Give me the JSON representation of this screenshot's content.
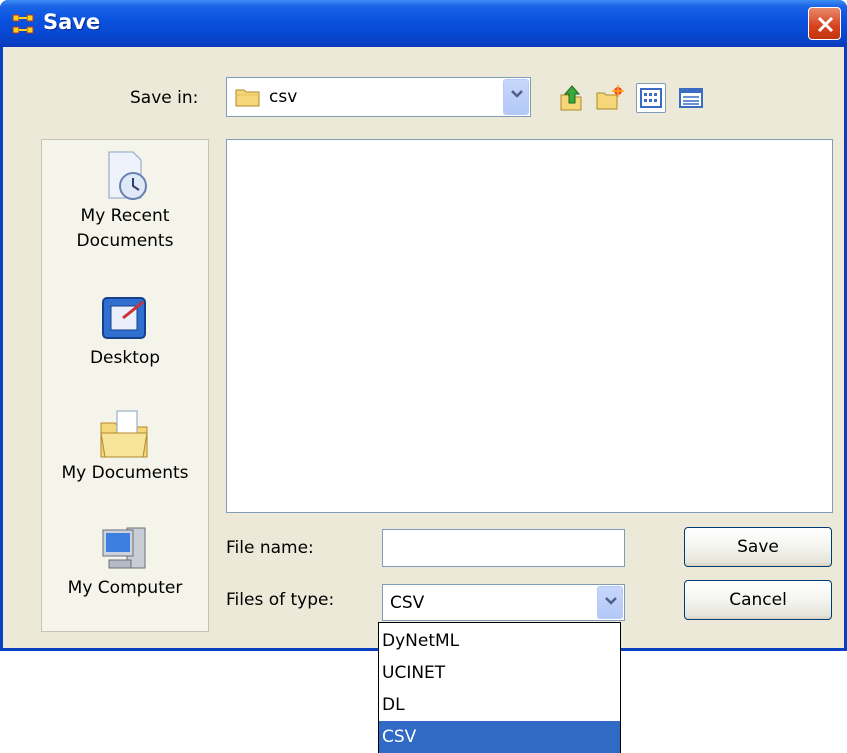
{
  "window": {
    "title": "Save"
  },
  "toolbar": {
    "save_in_label": "Save in:",
    "save_in_value": "csv"
  },
  "places": [
    {
      "label_line1": "My Recent",
      "label_line2": "Documents",
      "icon": "recent-documents-icon"
    },
    {
      "label_line1": "Desktop",
      "label_line2": "",
      "icon": "desktop-icon"
    },
    {
      "label_line1": "My Documents",
      "label_line2": "",
      "icon": "my-documents-icon"
    },
    {
      "label_line1": "My Computer",
      "label_line2": "",
      "icon": "my-computer-icon"
    }
  ],
  "form": {
    "file_name_label": "File name:",
    "file_name_value": "",
    "files_of_type_label": "Files of type:",
    "files_of_type_value": "CSV"
  },
  "buttons": {
    "save": "Save",
    "cancel": "Cancel"
  },
  "dropdown": {
    "options": [
      "DyNetML",
      "UCINET",
      "DL",
      "CSV"
    ],
    "selected": "CSV"
  },
  "colors": {
    "titlebar": "#0a54e0",
    "selection": "#316ac5",
    "frame": "#ece9d8"
  }
}
